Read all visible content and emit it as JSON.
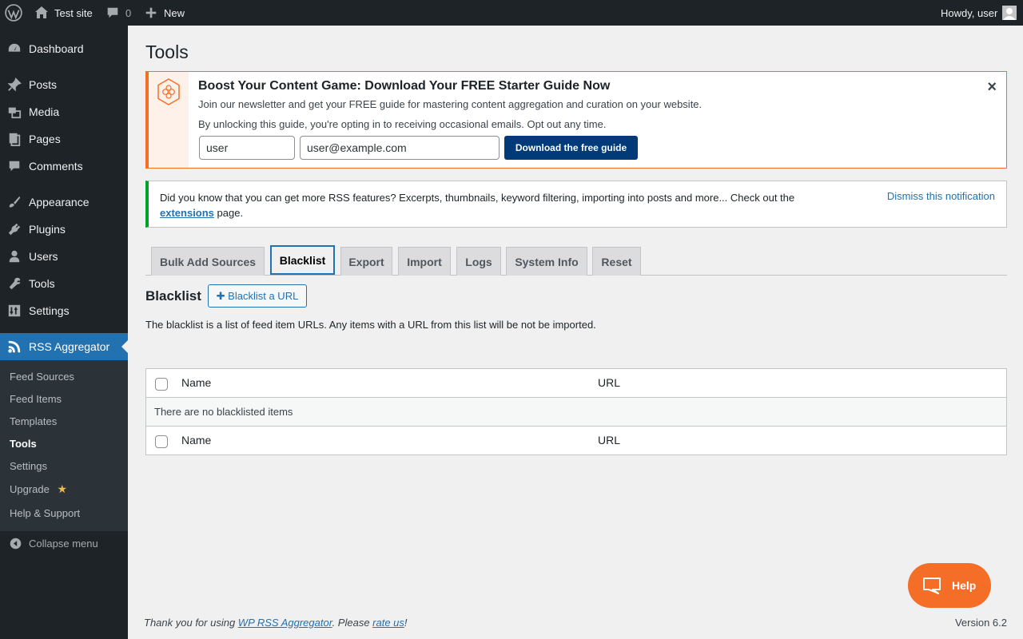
{
  "adminbar": {
    "site_name": "Test site",
    "comments_count": "0",
    "new_label": "New",
    "howdy": "Howdy, user"
  },
  "sidebar": {
    "items": [
      {
        "label": "Dashboard",
        "icon": "dashboard-icon"
      },
      {
        "label": "Posts",
        "icon": "pin-icon"
      },
      {
        "label": "Media",
        "icon": "media-icon"
      },
      {
        "label": "Pages",
        "icon": "pages-icon"
      },
      {
        "label": "Comments",
        "icon": "comment-icon"
      },
      {
        "label": "Appearance",
        "icon": "brush-icon"
      },
      {
        "label": "Plugins",
        "icon": "plug-icon"
      },
      {
        "label": "Users",
        "icon": "user-icon"
      },
      {
        "label": "Tools",
        "icon": "wrench-icon"
      },
      {
        "label": "Settings",
        "icon": "settings-icon"
      },
      {
        "label": "RSS Aggregator",
        "icon": "rss-icon"
      }
    ],
    "submenu": [
      {
        "label": "Feed Sources"
      },
      {
        "label": "Feed Items"
      },
      {
        "label": "Templates"
      },
      {
        "label": "Tools"
      },
      {
        "label": "Settings"
      },
      {
        "label": "Upgrade"
      },
      {
        "label": "Help & Support"
      }
    ],
    "collapse_label": "Collapse menu"
  },
  "page": {
    "title": "Tools"
  },
  "promo": {
    "heading": "Boost Your Content Game: Download Your FREE Starter Guide Now",
    "line1": "Join our newsletter and get your FREE guide for mastering content aggregation and curation on your website.",
    "line2": "By unlocking this guide, you're opting in to receiving occasional emails. Opt out any time.",
    "name_value": "user",
    "email_value": "user@example.com",
    "button_label": "Download the free guide"
  },
  "notice": {
    "text_before": "Did you know that you can get more RSS features? Excerpts, thumbnails, keyword filtering, importing into posts and more... Check out the ",
    "link_label": "extensions",
    "text_after": " page.",
    "dismiss_label": "Dismiss this notification"
  },
  "tabs": [
    {
      "label": "Bulk Add Sources"
    },
    {
      "label": "Blacklist"
    },
    {
      "label": "Export"
    },
    {
      "label": "Import"
    },
    {
      "label": "Logs"
    },
    {
      "label": "System Info"
    },
    {
      "label": "Reset"
    }
  ],
  "blacklist": {
    "title": "Blacklist",
    "add_button": "✚ Blacklist a URL",
    "description": "The blacklist is a list of feed item URLs. Any items with a URL from this list will be not be imported.",
    "col_name": "Name",
    "col_url": "URL",
    "empty_text": "There are no blacklisted items"
  },
  "help_button": "Help",
  "footer": {
    "text1": "Thank you for using ",
    "link1": "WP RSS Aggregator",
    "text2": ". Please ",
    "link2": "rate us",
    "text3": "!",
    "version": "Version 6.2"
  },
  "colors": {
    "accent": "#2271b1",
    "promo_border": "#f56e28",
    "notice_border": "#00a32a",
    "sidebar_bg": "#1d2327",
    "help_bg": "#f56e28"
  }
}
